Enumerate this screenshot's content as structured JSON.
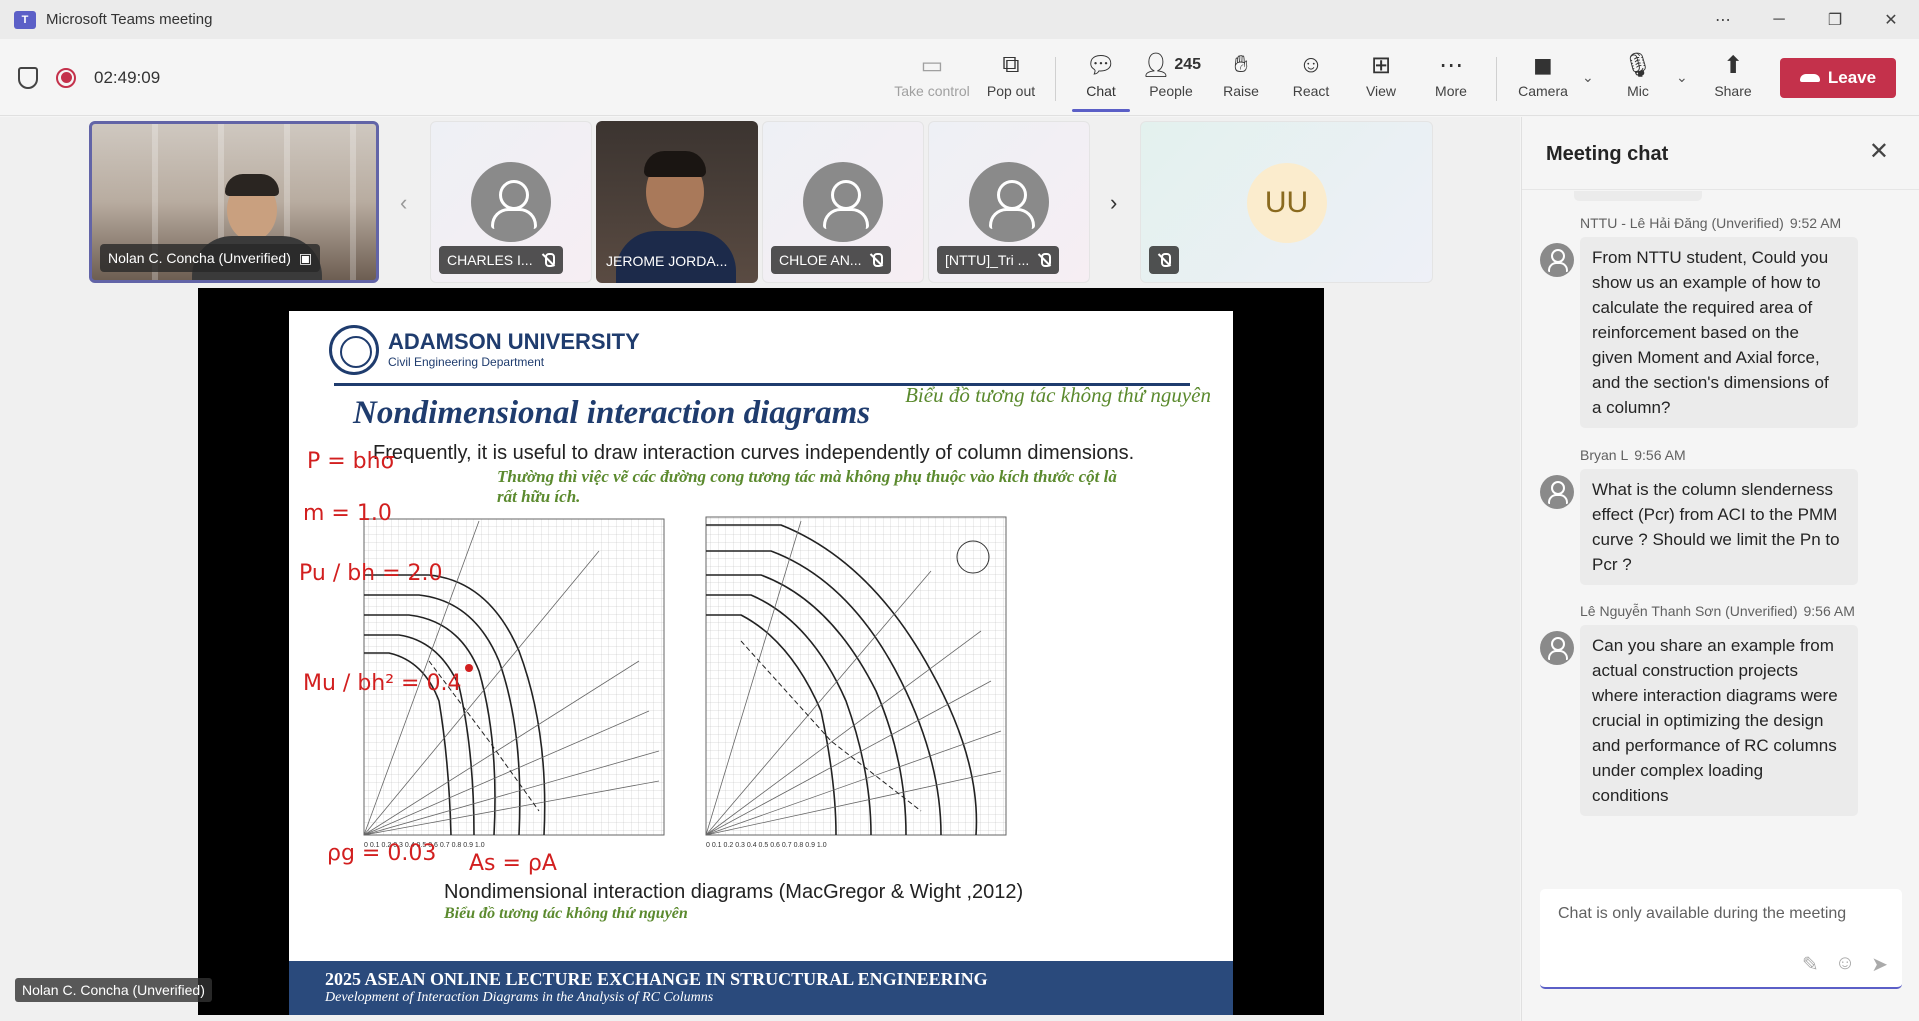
{
  "window": {
    "title": "Microsoft Teams meeting"
  },
  "toolbar": {
    "timer": "02:49:09",
    "take_control": "Take control",
    "pop_out": "Pop out",
    "chat": "Chat",
    "people_count": "245",
    "people": "People",
    "raise": "Raise",
    "react": "React",
    "view": "View",
    "more": "More",
    "camera": "Camera",
    "mic": "Mic",
    "share": "Share",
    "leave": "Leave"
  },
  "participants": [
    {
      "name": "Nolan C. Concha (Unverified)",
      "video": true
    },
    {
      "name": "CHARLES I...",
      "video": false
    },
    {
      "name": "JEROME JORDA...",
      "video": true
    },
    {
      "name": "CHLOE AN...",
      "video": false
    },
    {
      "name": "[NTTU]_Tri ...",
      "video": false
    },
    {
      "name": "UU",
      "initials": "UU",
      "video": false
    }
  ],
  "slide": {
    "university": "ADAMSON UNIVERSITY",
    "department": "Civil Engineering Department",
    "viet_title": "Biểu đồ tương tác không thứ nguyên",
    "title": "Nondimensional interaction diagrams",
    "body": "Frequently, it is useful to draw interaction curves independently of column dimensions.",
    "body_viet": "Thường thì việc vẽ các đường cong tương tác mà không phụ thuộc vào kích thước cột là rất hữu ích.",
    "caption": "Nondimensional interaction diagrams (MacGregor & Wight ,2012)",
    "caption_viet": "Biểu đồ tương tác không thứ nguyên",
    "footer_title": "2025 ASEAN ONLINE LECTURE EXCHANGE IN STRUCTURAL ENGINEERING",
    "footer_subtitle": "Development of Interaction Diagrams in the Analysis of RC Columns",
    "ink_notes": [
      "P = bhσ",
      "m = 1.0",
      "Pu / bh = 2.0",
      "Mu / bh² = 0.4",
      "ρg = 0.03",
      "As = ρA"
    ]
  },
  "speaker": "Nolan C. Concha (Unverified)",
  "chat": {
    "title": "Meeting chat",
    "messages": [
      {
        "author": "NTTU - Lê Hải Đăng (Unverified)",
        "time": "9:52 AM",
        "text": "From NTTU student, Could you show us an example of how to calculate the required area of reinforcement based on the given Moment and Axial force, and the section's dimensions of a column?"
      },
      {
        "author": "Bryan L",
        "time": "9:56 AM",
        "text": "What is the column slenderness effect (Pcr) from ACI to the PMM curve ? Should we limit the Pn to Pcr ?"
      },
      {
        "author": "Lê Nguyễn Thanh Sơn (Unverified)",
        "time": "9:56 AM",
        "text": "Can you share an example from actual construction projects where interaction diagrams were crucial in optimizing the design and performance of RC columns under complex loading conditions"
      }
    ],
    "input_placeholder": "Chat is only available during the meeting"
  }
}
